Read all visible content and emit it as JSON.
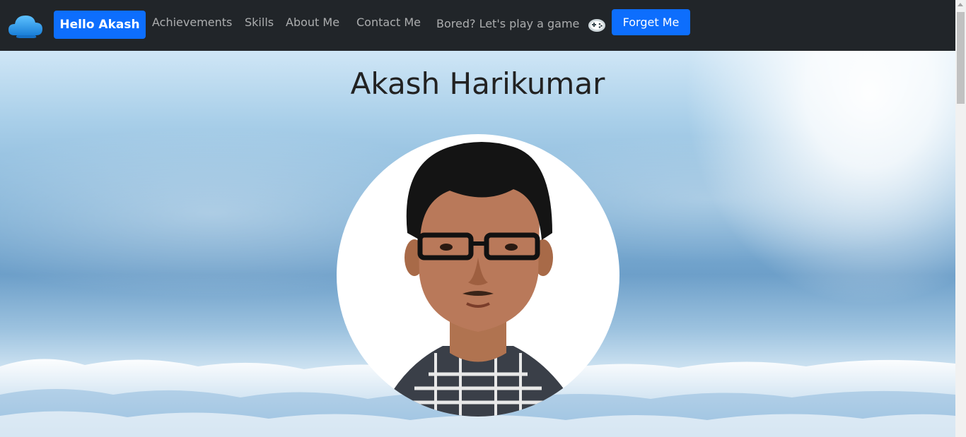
{
  "navbar": {
    "logo_icon": "cloud-logo-icon",
    "hello_button_label": "Hello Akash",
    "links": {
      "achievements": "Achievements",
      "skills": "Skills",
      "about": "About Me",
      "contact": "Contact Me",
      "game": "Bored? Let's play a game"
    },
    "game_icon": "gamepad-icon",
    "forget_button_label": "Forget Me",
    "background_color": "#212529",
    "accent_color": "#0d6efd"
  },
  "hero": {
    "title": "Akash Harikumar",
    "avatar": "profile-photo"
  }
}
